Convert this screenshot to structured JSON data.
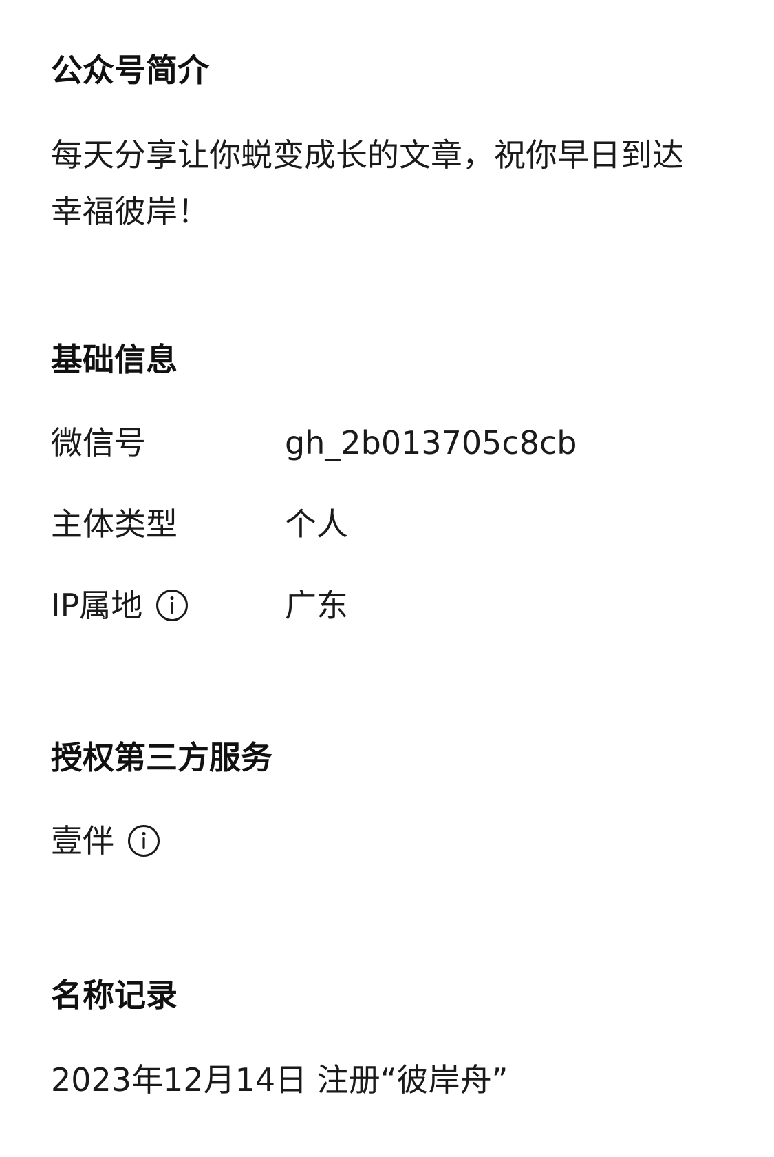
{
  "intro": {
    "title": "公众号简介",
    "text": "每天分享让你蜕变成长的文章，祝你早日到达幸福彼岸！"
  },
  "basic_info": {
    "title": "基础信息",
    "rows": [
      {
        "label": "微信号",
        "value": "gh_2b013705c8cb"
      },
      {
        "label": "主体类型",
        "value": "个人"
      },
      {
        "label": "IP属地",
        "value": "广东",
        "icon": "info-icon"
      }
    ]
  },
  "third_party": {
    "title": "授权第三方服务",
    "item": {
      "label": "壹伴",
      "icon": "info-icon"
    }
  },
  "name_record": {
    "title": "名称记录",
    "entry": "2023年12月14日 注册“彼岸舟”"
  },
  "colors": {
    "text": "#1a1a1a",
    "background": "#ffffff"
  }
}
